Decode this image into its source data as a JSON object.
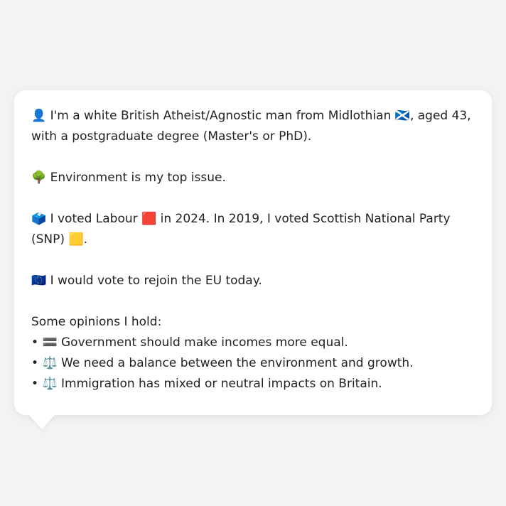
{
  "profile": {
    "identity_icon": "👤",
    "identity_text_before_flag": " I'm a white British Atheist/Agnostic man from Midlothian ",
    "identity_flag": "🏴󠁧󠁢󠁳󠁣󠁴󠁿",
    "identity_text_after_flag": ", aged 43, with a postgraduate degree (Master's or PhD).",
    "issue_icon": "🌳",
    "issue_text": " Environment is my top issue.",
    "vote_icon": "🗳️",
    "vote_text_1": " I voted Labour ",
    "labour_square": "🟥",
    "vote_text_2": " in 2024. In 2019, I voted Scottish National Party (SNP) ",
    "snp_square": "🟨",
    "vote_text_3": ".",
    "eu_icon": "🇪🇺",
    "eu_text": " I would vote to rejoin the EU today.",
    "opinions_heading": "Some opinions I hold:",
    "opinions": [
      {
        "bullet": "• ",
        "icon": "🟰",
        "text": " Government should make incomes more equal."
      },
      {
        "bullet": "• ",
        "icon": "⚖️",
        "text": " We need a balance between the environment and growth."
      },
      {
        "bullet": "• ",
        "icon": "⚖️",
        "text": " Immigration has mixed or neutral impacts on Britain."
      }
    ]
  }
}
